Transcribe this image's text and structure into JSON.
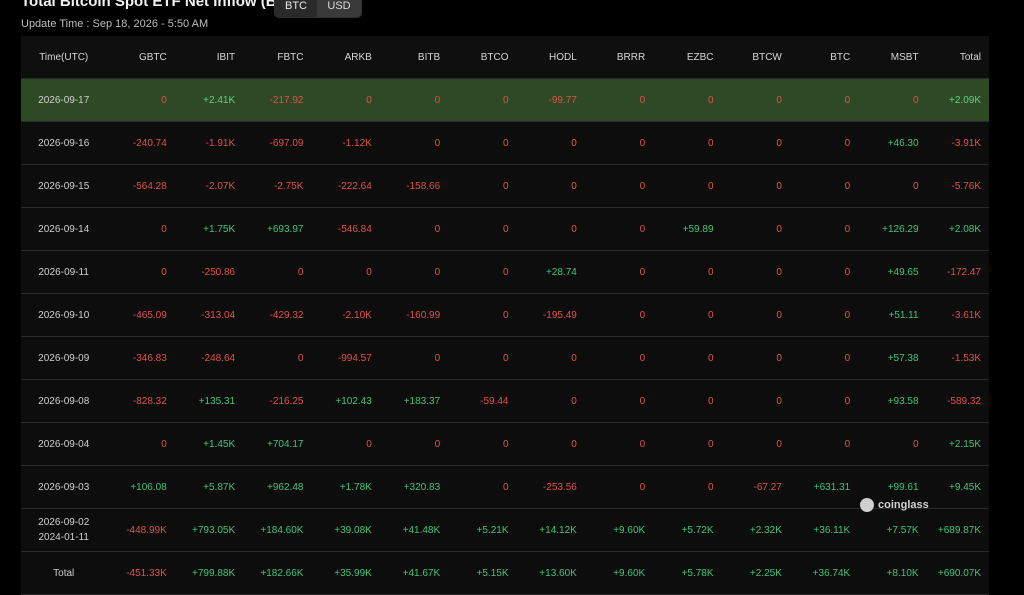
{
  "header": {
    "title": "Total Bitcoin Spot ETF Net Inflow (BTC)",
    "update_time": "Update Time : Sep 18, 2026 - 5:50 AM",
    "unit_options": [
      "BTC",
      "USD"
    ],
    "selected_unit": "BTC"
  },
  "table": {
    "columns": [
      "Time(UTC)",
      "GBTC",
      "IBIT",
      "FBTC",
      "ARKB",
      "BITB",
      "BTCO",
      "HODL",
      "BRRR",
      "EZBC",
      "BTCW",
      "BTC",
      "MSBT",
      "Total"
    ],
    "highlighted_row_index": 0,
    "rows": [
      {
        "date": "2026-09-17",
        "values": [
          "0",
          "+2.41K",
          "-217.92",
          "0",
          "0",
          "0",
          "-99.77",
          "0",
          "0",
          "0",
          "0",
          "0",
          "+2.09K"
        ]
      },
      {
        "date": "2026-09-16",
        "values": [
          "-240.74",
          "-1.91K",
          "-697.09",
          "-1.12K",
          "0",
          "0",
          "0",
          "0",
          "0",
          "0",
          "0",
          "+46.30",
          "-3.91K"
        ]
      },
      {
        "date": "2026-09-15",
        "values": [
          "-564.28",
          "-2.07K",
          "-2.75K",
          "-222.64",
          "-158.66",
          "0",
          "0",
          "0",
          "0",
          "0",
          "0",
          "0",
          "-5.76K"
        ]
      },
      {
        "date": "2026-09-14",
        "values": [
          "0",
          "+1.75K",
          "+693.97",
          "-546.84",
          "0",
          "0",
          "0",
          "0",
          "+59.89",
          "0",
          "0",
          "+126.29",
          "+2.08K"
        ]
      },
      {
        "date": "2026-09-11",
        "values": [
          "0",
          "-250.86",
          "0",
          "0",
          "0",
          "0",
          "+28.74",
          "0",
          "0",
          "0",
          "0",
          "+49.65",
          "-172.47"
        ]
      },
      {
        "date": "2026-09-10",
        "values": [
          "-465.09",
          "-313.04",
          "-429.32",
          "-2.10K",
          "-160.99",
          "0",
          "-195.49",
          "0",
          "0",
          "0",
          "0",
          "+51.11",
          "-3.61K"
        ]
      },
      {
        "date": "2026-09-09",
        "values": [
          "-346.83",
          "-248.64",
          "0",
          "-994.57",
          "0",
          "0",
          "0",
          "0",
          "0",
          "0",
          "0",
          "+57.38",
          "-1.53K"
        ]
      },
      {
        "date": "2026-09-08",
        "values": [
          "-828.32",
          "+135.31",
          "-216.25",
          "+102.43",
          "+183.37",
          "-59.44",
          "0",
          "0",
          "0",
          "0",
          "0",
          "+93.58",
          "-589.32"
        ]
      },
      {
        "date": "2026-09-04",
        "values": [
          "0",
          "+1.45K",
          "+704.17",
          "0",
          "0",
          "0",
          "0",
          "0",
          "0",
          "0",
          "0",
          "0",
          "+2.15K"
        ]
      },
      {
        "date": "2026-09-03",
        "values": [
          "+106.08",
          "+5.87K",
          "+962.48",
          "+1.78K",
          "+320.83",
          "0",
          "-253.56",
          "0",
          "0",
          "-67.27",
          "+631.31",
          "+99.61",
          "+9.45K"
        ]
      },
      {
        "date": "2026-09-02\n2024-01-11",
        "values": [
          "-448.99K",
          "+793.05K",
          "+184.60K",
          "+39.08K",
          "+41.48K",
          "+5.21K",
          "+14.12K",
          "+9.60K",
          "+5.72K",
          "+2.32K",
          "+36.11K",
          "+7.57K",
          "+689.87K"
        ]
      },
      {
        "date": "Total",
        "values": [
          "-451.33K",
          "+799.88K",
          "+182.66K",
          "+35.99K",
          "+41.67K",
          "+5.15K",
          "+13.60K",
          "+9.60K",
          "+5.78K",
          "+2.25K",
          "+36.74K",
          "+8.10K",
          "+690.07K"
        ]
      }
    ]
  },
  "watermark": {
    "text": "coinglass",
    "icon": "coinglass-logo-icon"
  },
  "colors": {
    "positive": "#3fc47d",
    "negative": "#e0504f",
    "highlight": "#2e4a24",
    "background": "#000000"
  }
}
